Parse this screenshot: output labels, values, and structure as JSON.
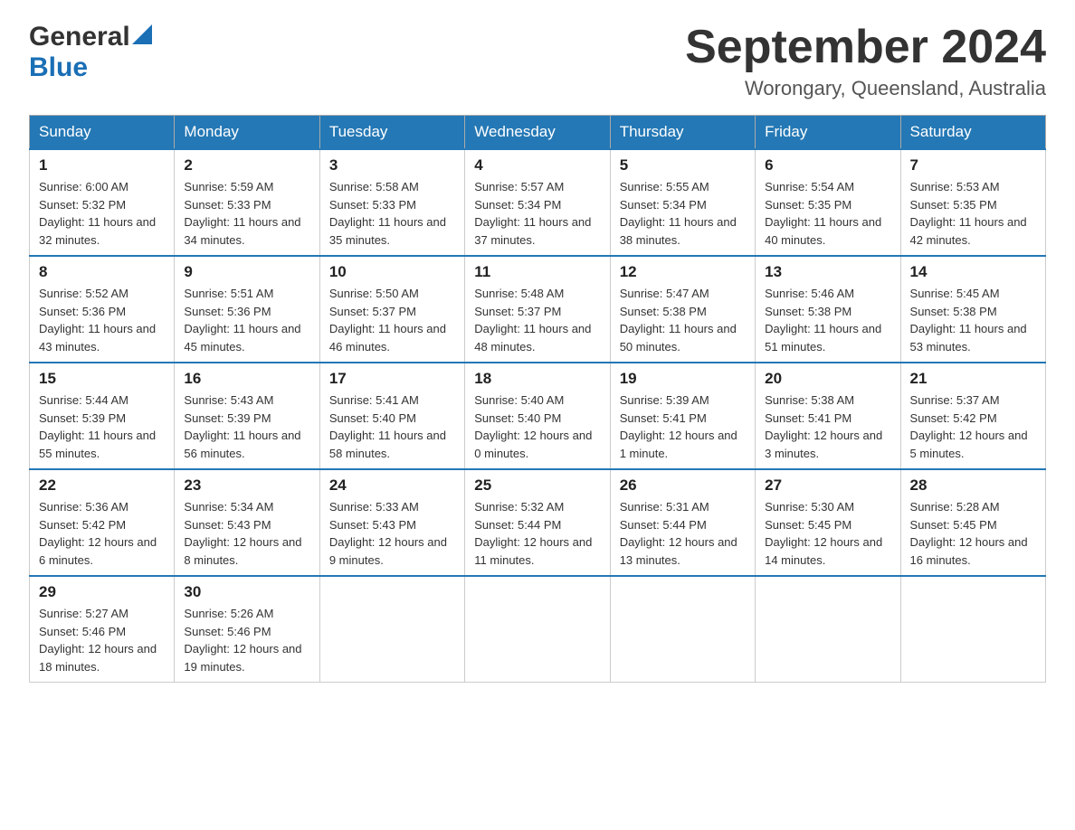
{
  "logo": {
    "general": "General",
    "blue": "Blue"
  },
  "title": {
    "month": "September 2024",
    "location": "Worongary, Queensland, Australia"
  },
  "weekdays": [
    "Sunday",
    "Monday",
    "Tuesday",
    "Wednesday",
    "Thursday",
    "Friday",
    "Saturday"
  ],
  "weeks": [
    [
      {
        "day": "1",
        "sunrise": "6:00 AM",
        "sunset": "5:32 PM",
        "daylight": "11 hours and 32 minutes."
      },
      {
        "day": "2",
        "sunrise": "5:59 AM",
        "sunset": "5:33 PM",
        "daylight": "11 hours and 34 minutes."
      },
      {
        "day": "3",
        "sunrise": "5:58 AM",
        "sunset": "5:33 PM",
        "daylight": "11 hours and 35 minutes."
      },
      {
        "day": "4",
        "sunrise": "5:57 AM",
        "sunset": "5:34 PM",
        "daylight": "11 hours and 37 minutes."
      },
      {
        "day": "5",
        "sunrise": "5:55 AM",
        "sunset": "5:34 PM",
        "daylight": "11 hours and 38 minutes."
      },
      {
        "day": "6",
        "sunrise": "5:54 AM",
        "sunset": "5:35 PM",
        "daylight": "11 hours and 40 minutes."
      },
      {
        "day": "7",
        "sunrise": "5:53 AM",
        "sunset": "5:35 PM",
        "daylight": "11 hours and 42 minutes."
      }
    ],
    [
      {
        "day": "8",
        "sunrise": "5:52 AM",
        "sunset": "5:36 PM",
        "daylight": "11 hours and 43 minutes."
      },
      {
        "day": "9",
        "sunrise": "5:51 AM",
        "sunset": "5:36 PM",
        "daylight": "11 hours and 45 minutes."
      },
      {
        "day": "10",
        "sunrise": "5:50 AM",
        "sunset": "5:37 PM",
        "daylight": "11 hours and 46 minutes."
      },
      {
        "day": "11",
        "sunrise": "5:48 AM",
        "sunset": "5:37 PM",
        "daylight": "11 hours and 48 minutes."
      },
      {
        "day": "12",
        "sunrise": "5:47 AM",
        "sunset": "5:38 PM",
        "daylight": "11 hours and 50 minutes."
      },
      {
        "day": "13",
        "sunrise": "5:46 AM",
        "sunset": "5:38 PM",
        "daylight": "11 hours and 51 minutes."
      },
      {
        "day": "14",
        "sunrise": "5:45 AM",
        "sunset": "5:38 PM",
        "daylight": "11 hours and 53 minutes."
      }
    ],
    [
      {
        "day": "15",
        "sunrise": "5:44 AM",
        "sunset": "5:39 PM",
        "daylight": "11 hours and 55 minutes."
      },
      {
        "day": "16",
        "sunrise": "5:43 AM",
        "sunset": "5:39 PM",
        "daylight": "11 hours and 56 minutes."
      },
      {
        "day": "17",
        "sunrise": "5:41 AM",
        "sunset": "5:40 PM",
        "daylight": "11 hours and 58 minutes."
      },
      {
        "day": "18",
        "sunrise": "5:40 AM",
        "sunset": "5:40 PM",
        "daylight": "12 hours and 0 minutes."
      },
      {
        "day": "19",
        "sunrise": "5:39 AM",
        "sunset": "5:41 PM",
        "daylight": "12 hours and 1 minute."
      },
      {
        "day": "20",
        "sunrise": "5:38 AM",
        "sunset": "5:41 PM",
        "daylight": "12 hours and 3 minutes."
      },
      {
        "day": "21",
        "sunrise": "5:37 AM",
        "sunset": "5:42 PM",
        "daylight": "12 hours and 5 minutes."
      }
    ],
    [
      {
        "day": "22",
        "sunrise": "5:36 AM",
        "sunset": "5:42 PM",
        "daylight": "12 hours and 6 minutes."
      },
      {
        "day": "23",
        "sunrise": "5:34 AM",
        "sunset": "5:43 PM",
        "daylight": "12 hours and 8 minutes."
      },
      {
        "day": "24",
        "sunrise": "5:33 AM",
        "sunset": "5:43 PM",
        "daylight": "12 hours and 9 minutes."
      },
      {
        "day": "25",
        "sunrise": "5:32 AM",
        "sunset": "5:44 PM",
        "daylight": "12 hours and 11 minutes."
      },
      {
        "day": "26",
        "sunrise": "5:31 AM",
        "sunset": "5:44 PM",
        "daylight": "12 hours and 13 minutes."
      },
      {
        "day": "27",
        "sunrise": "5:30 AM",
        "sunset": "5:45 PM",
        "daylight": "12 hours and 14 minutes."
      },
      {
        "day": "28",
        "sunrise": "5:28 AM",
        "sunset": "5:45 PM",
        "daylight": "12 hours and 16 minutes."
      }
    ],
    [
      {
        "day": "29",
        "sunrise": "5:27 AM",
        "sunset": "5:46 PM",
        "daylight": "12 hours and 18 minutes."
      },
      {
        "day": "30",
        "sunrise": "5:26 AM",
        "sunset": "5:46 PM",
        "daylight": "12 hours and 19 minutes."
      },
      null,
      null,
      null,
      null,
      null
    ]
  ],
  "labels": {
    "sunrise": "Sunrise:",
    "sunset": "Sunset:",
    "daylight": "Daylight:"
  }
}
